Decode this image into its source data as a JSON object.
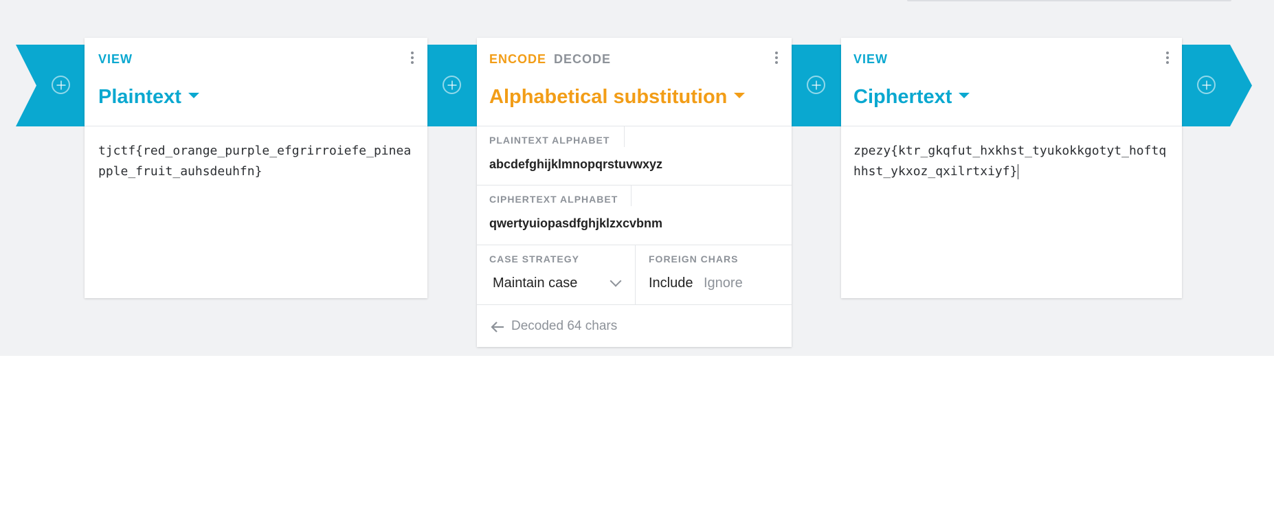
{
  "colors": {
    "accent": "#0aa8d0",
    "encode": "#f29d17",
    "muted": "#8d9299",
    "band": "#0aa8d0"
  },
  "left_card": {
    "mode_label": "VIEW",
    "title": "Plaintext",
    "content": "tjctf{red_orange_purple_efgrirroiefe_pineapple_fruit_auhsdeuhfn}"
  },
  "middle_card": {
    "encode_label": "ENCODE",
    "decode_label": "DECODE",
    "title": "Alphabetical substitution",
    "plaintext_alphabet_label": "PLAINTEXT ALPHABET",
    "plaintext_alphabet": "abcdefghijklmnopqrstuvwxyz",
    "ciphertext_alphabet_label": "CIPHERTEXT ALPHABET",
    "ciphertext_alphabet": "qwertyuiopasdfghjklzxcvbnm",
    "case_strategy_label": "CASE STRATEGY",
    "case_strategy_value": "Maintain case",
    "foreign_chars_label": "FOREIGN CHARS",
    "foreign_include": "Include",
    "foreign_ignore": "Ignore",
    "status": "Decoded 64 chars"
  },
  "right_card": {
    "mode_label": "VIEW",
    "title": "Ciphertext",
    "content": "zpezy{ktr_gkqfut_hxkhst_tyukokkgotyt_hoftqhhst_ykxoz_qxilrtxiyf}"
  },
  "icons": {
    "add": "plus-circle-icon",
    "menu": "more-vertical-icon",
    "dropdown": "caret-down-icon",
    "select": "chevron-down-icon",
    "back": "arrow-left-icon"
  }
}
